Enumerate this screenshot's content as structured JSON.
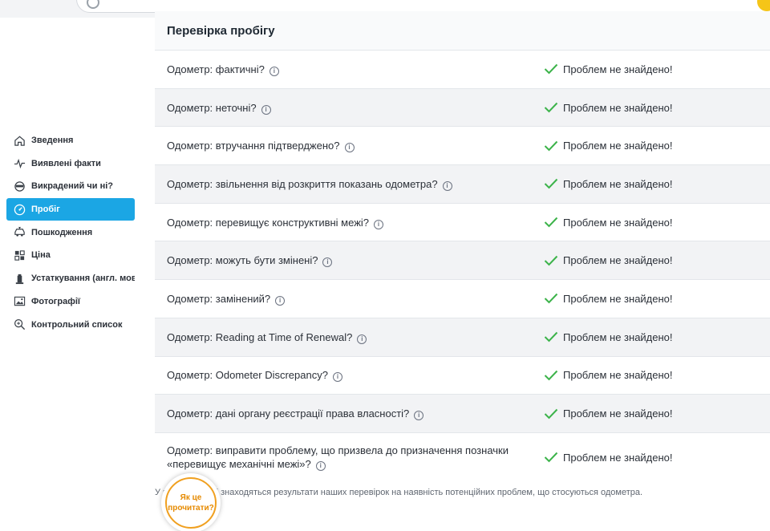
{
  "colors": {
    "accent": "#1ba6e4",
    "check": "#3cb34a",
    "help_border": "#f0a020",
    "help_text": "#e68a00"
  },
  "sidebar": {
    "items": [
      {
        "label": "Зведення",
        "icon": "home-icon",
        "active": false
      },
      {
        "label": "Виявлені факти",
        "icon": "pulse-icon",
        "active": false
      },
      {
        "label": "Викрадений чи ні?",
        "icon": "thief-icon",
        "active": false
      },
      {
        "label": "Пробіг",
        "icon": "odometer-icon",
        "active": true
      },
      {
        "label": "Пошкодження",
        "icon": "car-damage-icon",
        "active": false
      },
      {
        "label": "Ціна",
        "icon": "price-grid-icon",
        "active": false
      },
      {
        "label": "Устаткування (англ. мов",
        "icon": "equipment-icon",
        "active": false
      },
      {
        "label": "Фотографії",
        "icon": "photo-icon",
        "active": false
      },
      {
        "label": "Контрольний список",
        "icon": "magnifier-icon",
        "active": false
      }
    ]
  },
  "main": {
    "title": "Перевірка пробігу",
    "rows": [
      {
        "label": "Одометр: фактичні?",
        "status": "Проблем не знайдено!"
      },
      {
        "label": "Одометр: неточні?",
        "status": "Проблем не знайдено!"
      },
      {
        "label": "Одометр: втручання підтверджено?",
        "status": "Проблем не знайдено!"
      },
      {
        "label": "Одометр: звільнення від розкриття показань одометра?",
        "status": "Проблем не знайдено!"
      },
      {
        "label": "Одометр: перевищує конструктивні межі?",
        "status": "Проблем не знайдено!"
      },
      {
        "label": "Одометр: можуть бути змінені?",
        "status": "Проблем не знайдено!"
      },
      {
        "label": "Одометр: замінений?",
        "status": "Проблем не знайдено!"
      },
      {
        "label": "Одометр: Reading at Time of Renewal?",
        "status": "Проблем не знайдено!"
      },
      {
        "label": "Одометр: Odometer Discrepancy?",
        "status": "Проблем не знайдено!"
      },
      {
        "label": "Одометр: дані органу реєстрації права власності?",
        "status": "Проблем не знайдено!"
      },
      {
        "label": "Одометр: виправити проблему, що призвела до призначення позначки «перевищує механічні межі»?",
        "status": "Проблем не знайдено!"
      }
    ],
    "footnote": "У цьому розділі знаходяться результати наших перевірок на наявність потенційних проблем, що стосуються одометра."
  },
  "help": {
    "line1": "Як це",
    "line2": "прочитати?"
  }
}
